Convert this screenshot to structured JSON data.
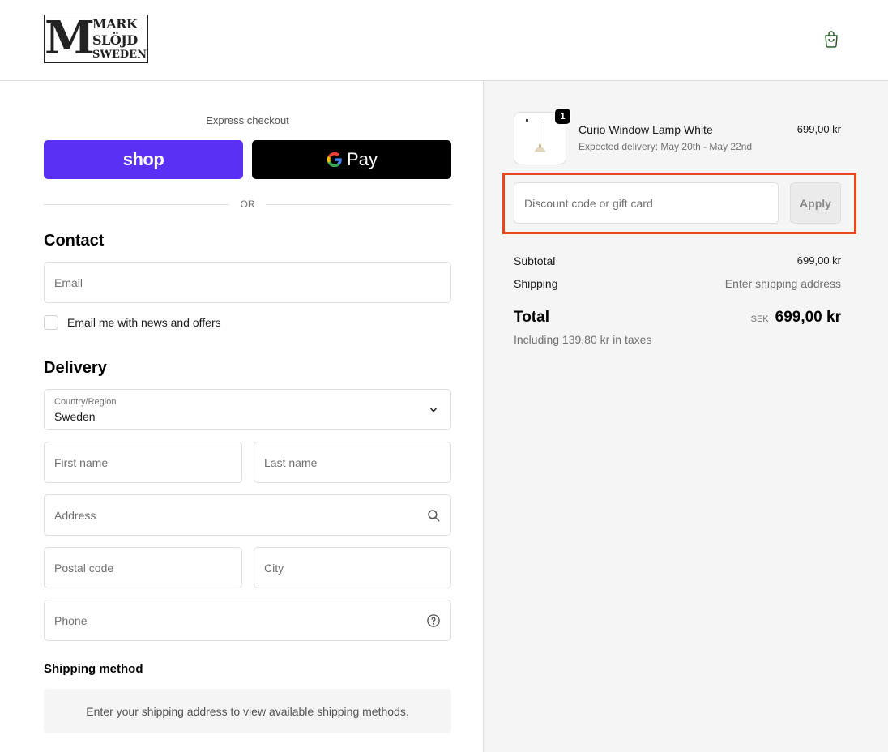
{
  "header": {
    "logo_letter": "M",
    "logo_line1": "MARK",
    "logo_line2": "SLÖJD",
    "logo_line3": "SWEDEN",
    "cart_icon": "shopping-bag-icon"
  },
  "express": {
    "label": "Express checkout",
    "shop_label": "shop",
    "gpay_g": "G",
    "gpay_label": "Pay",
    "or_text": "OR"
  },
  "contact": {
    "title": "Contact",
    "email_placeholder": "Email",
    "newsletter_label": "Email me with news and offers"
  },
  "delivery": {
    "title": "Delivery",
    "country_label": "Country/Region",
    "country_value": "Sweden",
    "first_name_placeholder": "First name",
    "last_name_placeholder": "Last name",
    "address_placeholder": "Address",
    "postal_placeholder": "Postal code",
    "city_placeholder": "City",
    "phone_placeholder": "Phone"
  },
  "shipping_method": {
    "title": "Shipping method",
    "message": "Enter your shipping address to view available shipping methods."
  },
  "summary": {
    "item": {
      "quantity": "1",
      "name": "Curio Window Lamp White",
      "delivery": "Expected delivery: May 20th - May 22nd",
      "price": "699,00 kr"
    },
    "discount_placeholder": "Discount code or gift card",
    "apply_label": "Apply",
    "subtotal_label": "Subtotal",
    "subtotal_value": "699,00 kr",
    "shipping_label": "Shipping",
    "shipping_value": "Enter shipping address",
    "total_label": "Total",
    "total_currency": "SEK",
    "total_value": "699,00 kr",
    "taxes": "Including 139,80 kr in taxes"
  },
  "colors": {
    "shop_purple": "#5a31f4",
    "highlight": "#e8481b"
  }
}
